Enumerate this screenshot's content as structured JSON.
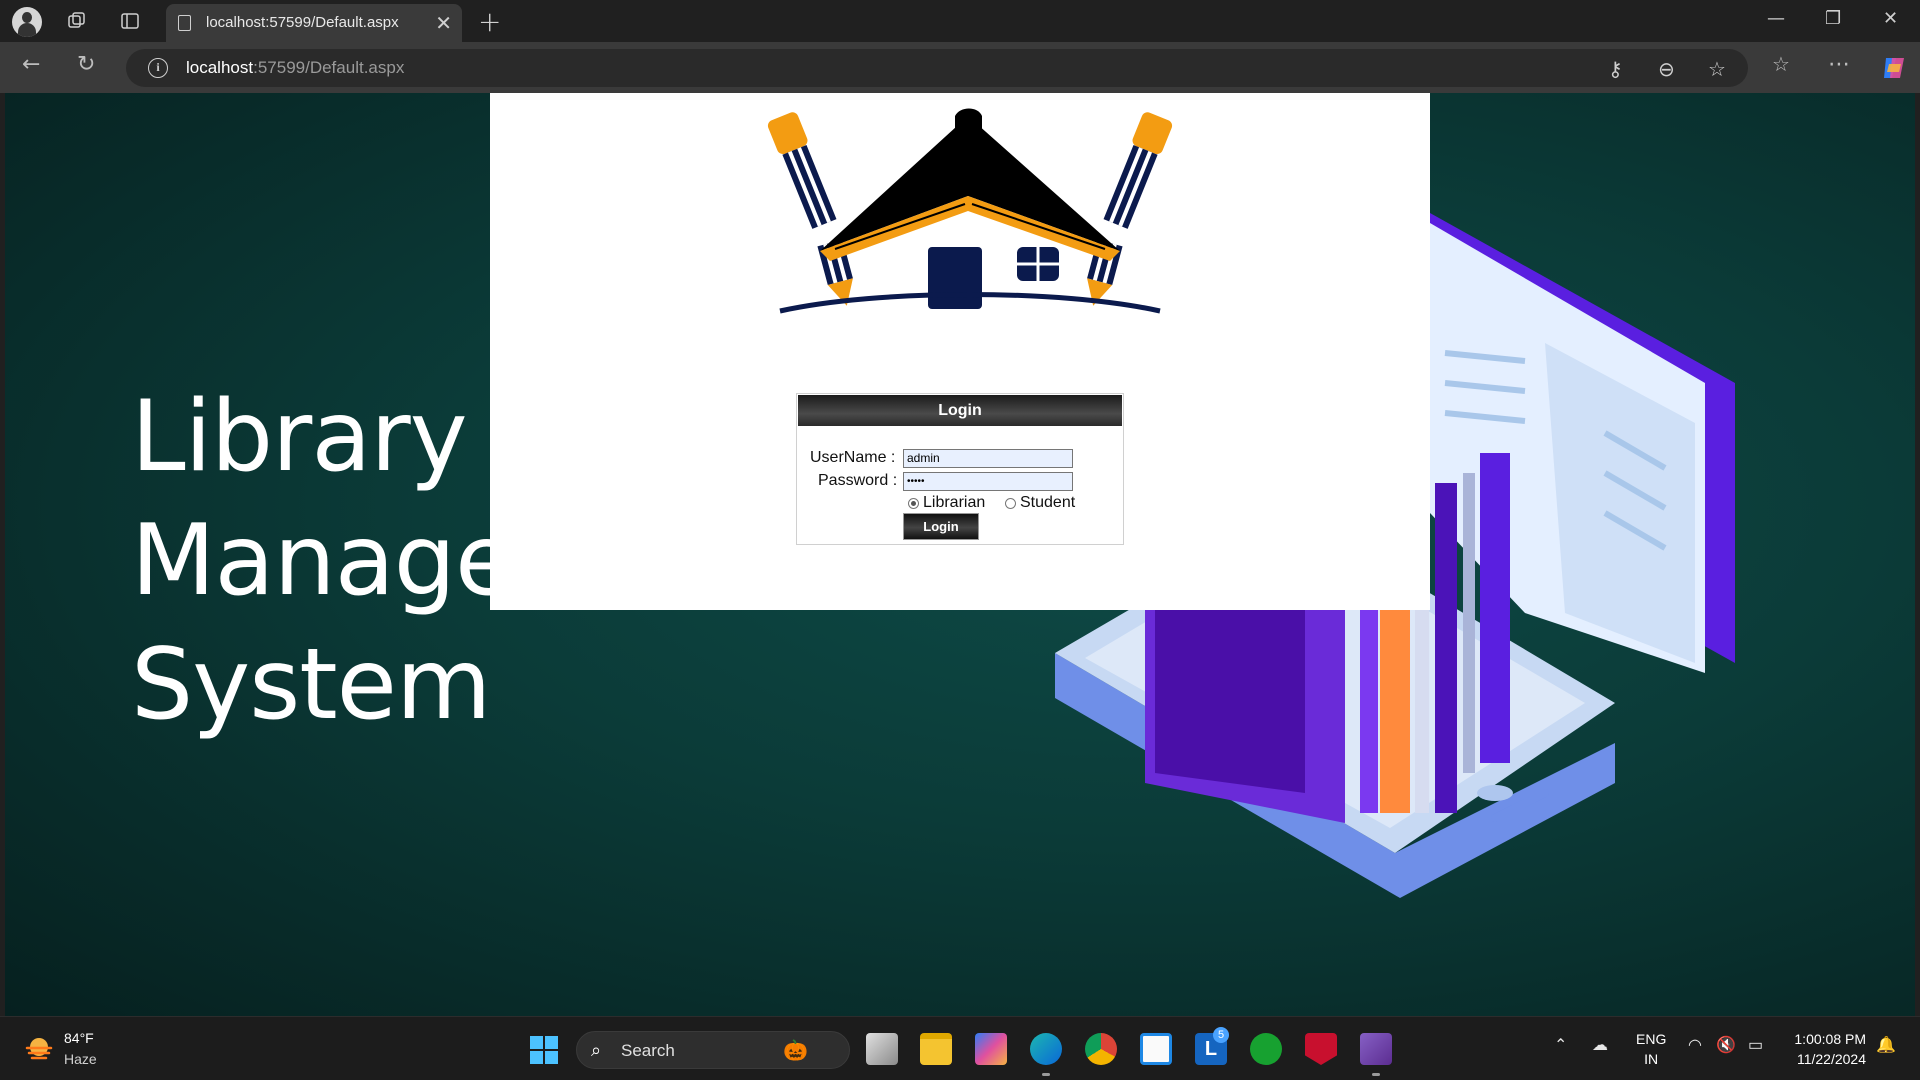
{
  "browser": {
    "tab_title": "localhost:57599/Default.aspx",
    "url_host": "localhost",
    "url_rest": ":57599/Default.aspx"
  },
  "page": {
    "hero_line1": "Library",
    "hero_line2": "Management",
    "hero_line3": "System",
    "login": {
      "header": "Login",
      "username_label": "UserName :",
      "username_value": "admin",
      "password_label": "Password :",
      "password_value": "•••••",
      "role_options": [
        "Librarian",
        "Student"
      ],
      "role_selected": "Librarian",
      "button_label": "Login"
    }
  },
  "taskbar": {
    "temperature": "84°F",
    "condition": "Haze",
    "search_placeholder": "Search",
    "language": "ENG",
    "region": "IN",
    "time": "1:00:08 PM",
    "date": "11/22/2024",
    "badge_count": "5",
    "pinned_apps": [
      "task-view",
      "file-explorer",
      "copilot",
      "edge",
      "chrome",
      "microsoft-store",
      "lens",
      "xbox",
      "mcafee",
      "visual-studio"
    ]
  },
  "colors": {
    "page_bg": "#0b3b38",
    "accent_orange": "#f39c12",
    "logo_navy": "#0b1a4d",
    "book_purple": "#5a1fe0"
  }
}
